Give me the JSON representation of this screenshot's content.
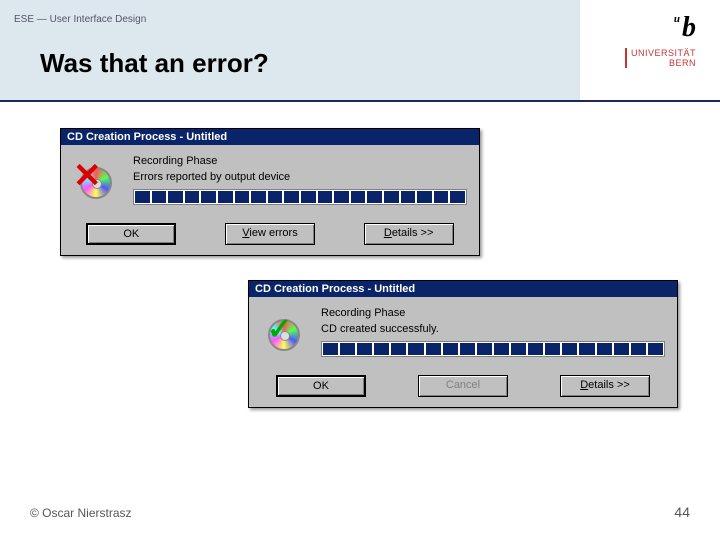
{
  "header": {
    "breadcrumb": "ESE — User Interface Design",
    "title": "Was that an error?"
  },
  "logo": {
    "sup": "u",
    "letter": "b",
    "uni1": "UNIVERSITÄT",
    "uni2": "BERN"
  },
  "dialog1": {
    "title": "CD Creation Process - Untitled",
    "phase": "Recording Phase",
    "status": "Errors reported by output device",
    "btn_ok": "OK",
    "btn_view_u": "V",
    "btn_view_rest": "iew errors",
    "btn_details_u": "D",
    "btn_details_rest": "etails >>"
  },
  "dialog2": {
    "title": "CD Creation Process - Untitled",
    "phase": "Recording Phase",
    "status": "CD created successfuly.",
    "btn_ok": "OK",
    "btn_cancel": "Cancel",
    "btn_details_u": "D",
    "btn_details_rest": "etails >>"
  },
  "footer": {
    "author": "© Oscar Nierstrasz",
    "page": "44"
  }
}
